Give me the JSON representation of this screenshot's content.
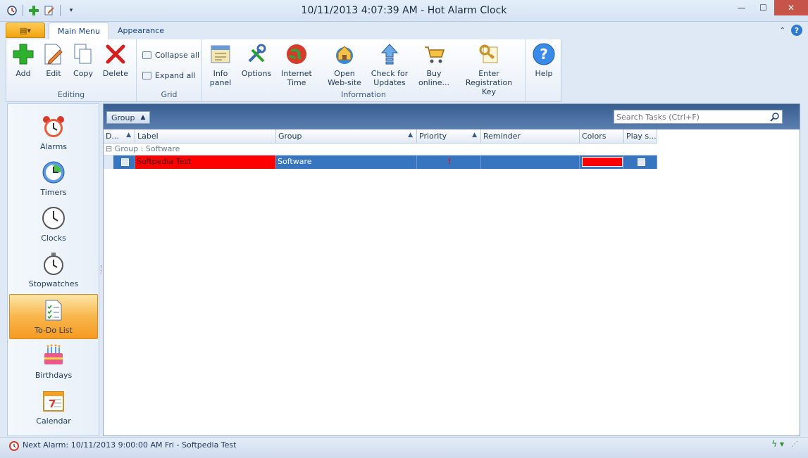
{
  "window": {
    "title": "10/11/2013 4:07:39 AM - Hot Alarm Clock",
    "minimize": "—",
    "maximize": "☐",
    "close": "✕"
  },
  "tabs": {
    "app_button": "▤▾",
    "items": [
      {
        "label": "Main Menu",
        "active": true
      },
      {
        "label": "Appearance",
        "active": false
      }
    ]
  },
  "ribbon": {
    "editing": {
      "label": "Editing",
      "buttons": [
        {
          "label": "Add",
          "icon": "add-icon"
        },
        {
          "label": "Edit",
          "icon": "edit-icon"
        },
        {
          "label": "Copy",
          "icon": "copy-icon"
        },
        {
          "label": "Delete",
          "icon": "delete-icon"
        }
      ]
    },
    "grid": {
      "label": "Grid",
      "collapse_all": "Collapse all",
      "expand_all": "Expand all"
    },
    "information": {
      "label": "Information",
      "buttons": [
        {
          "label1": "Info",
          "label2": "panel",
          "icon": "info-panel-icon"
        },
        {
          "label1": "Options",
          "label2": "",
          "icon": "options-icon"
        },
        {
          "label1": "Internet",
          "label2": "Time",
          "icon": "globe-icon"
        },
        {
          "label1": "Open",
          "label2": "Web-site",
          "icon": "website-icon"
        },
        {
          "label1": "Check for",
          "label2": "Updates",
          "icon": "update-icon"
        },
        {
          "label1": "Buy",
          "label2": "online...",
          "icon": "cart-icon"
        },
        {
          "label1": "Enter",
          "label2": "Registration Key",
          "icon": "key-icon"
        }
      ]
    },
    "help": {
      "label": "Help",
      "icon": "help-icon"
    }
  },
  "nav": {
    "items": [
      {
        "label": "Alarms",
        "icon": "alarm-clock-icon"
      },
      {
        "label": "Timers",
        "icon": "timer-icon"
      },
      {
        "label": "Clocks",
        "icon": "clock-icon"
      },
      {
        "label": "Stopwatches",
        "icon": "stopwatch-icon"
      },
      {
        "label": "To-Do List",
        "icon": "todo-icon",
        "active": true
      },
      {
        "label": "Birthdays",
        "icon": "cake-icon"
      },
      {
        "label": "Calendar",
        "icon": "calendar-icon"
      }
    ]
  },
  "main": {
    "group_chip": "Group",
    "search_placeholder": "Search Tasks (Ctrl+F)",
    "columns": [
      "D...",
      "Label",
      "Group",
      "Priority",
      "Reminder",
      "Colors",
      "Play s..."
    ],
    "group_row": "⊟ Group : Software",
    "row": {
      "label": "Softpedia Test",
      "group": "Software",
      "priority": "!",
      "reminder": "",
      "color": "#ff0000"
    }
  },
  "status": {
    "text": "Next Alarm: 10/11/2013 9:00:00 AM Fri - Softpedia Test",
    "right_icon": "ϟ ▾"
  },
  "colors": {
    "accent": "#3875c0",
    "nav_active": "#f8b64c",
    "row_color": "#ff0000"
  }
}
